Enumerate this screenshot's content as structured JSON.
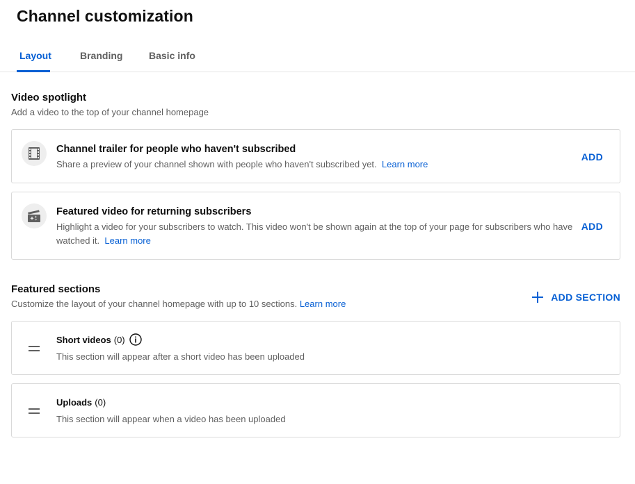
{
  "header": {
    "title": "Channel customization"
  },
  "tabs": [
    {
      "label": "Layout",
      "active": true
    },
    {
      "label": "Branding",
      "active": false
    },
    {
      "label": "Basic info",
      "active": false
    }
  ],
  "video_spotlight": {
    "title": "Video spotlight",
    "description": "Add a video to the top of your channel homepage",
    "cards": [
      {
        "icon": "film-icon",
        "title": "Channel trailer for people who haven't subscribed",
        "description": "Share a preview of your channel shown with people who haven't subscribed yet.",
        "learn_more": "Learn more",
        "action": "ADD"
      },
      {
        "icon": "sparkle-clapper-icon",
        "title": "Featured video for returning subscribers",
        "description": "Highlight a video for your subscribers to watch. This video won't be shown again at the top of your page for subscribers who have watched it.",
        "learn_more": "Learn more",
        "action": "ADD"
      }
    ]
  },
  "featured_sections": {
    "title": "Featured sections",
    "description": "Customize the layout of your channel homepage with up to 10 sections.",
    "learn_more": "Learn more",
    "add_section_label": "ADD SECTION",
    "sections": [
      {
        "title": "Short videos",
        "count": "(0)",
        "info_icon": "info-icon",
        "description": "This section will appear after a short video has been uploaded"
      },
      {
        "title": "Uploads",
        "count": "(0)",
        "description": "This section will appear when a video has been uploaded"
      }
    ]
  },
  "colors": {
    "accent": "#065fd4",
    "text": "#0f0f0f",
    "secondary_text": "#606060",
    "border": "#d9d9d9"
  }
}
